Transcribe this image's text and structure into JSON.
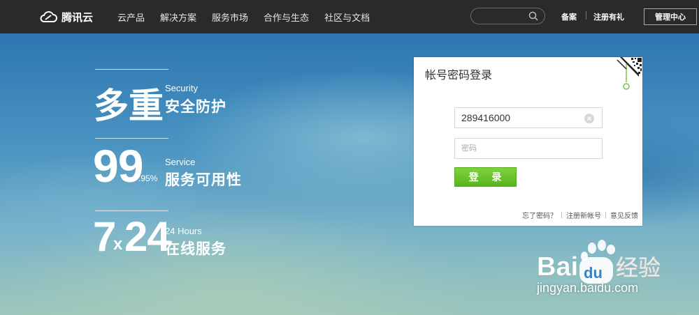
{
  "header": {
    "logo_text": "腾讯云",
    "nav": [
      "云产品",
      "解决方案",
      "服务市场",
      "合作与生态",
      "社区与文档"
    ],
    "search_placeholder": "",
    "record_link": "备案",
    "register_gift_link": "注册有礼",
    "console_button": "管理中心"
  },
  "features": [
    {
      "big": "多重",
      "en": "Security",
      "cn": "安全防护"
    },
    {
      "big": "99",
      "fraction": ".95%",
      "en": "Service",
      "cn": "服务可用性"
    },
    {
      "big_a": "7",
      "big_x": "x",
      "big_b": "24",
      "en": "24 Hours",
      "cn": "在线服务"
    }
  ],
  "login": {
    "title": "帐号密码登录",
    "account_value": "289416000",
    "password_placeholder": "密码",
    "submit_label": "登 录",
    "forgot_link": "忘了密码？",
    "register_link": "注册新帐号",
    "feedback_link": "意见反馈"
  },
  "watermark": {
    "brand_text": "Bai",
    "brand_paw": "du",
    "brand_cn": "经验",
    "url": "jingyan.baidu.com"
  },
  "colors": {
    "topbar": "#2a2a2a",
    "login_button": "#62bc26",
    "sky": "#3a7fb4"
  }
}
